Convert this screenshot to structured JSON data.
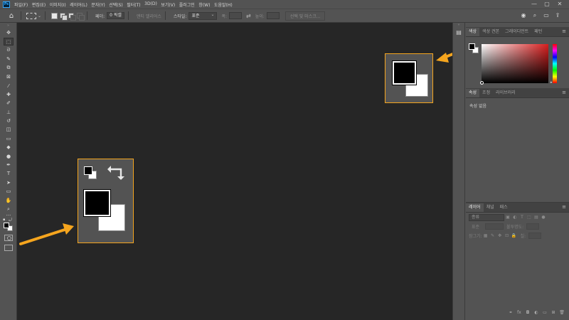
{
  "menubar": {
    "app_icon": "Ps",
    "items": [
      "파일(F)",
      "편집(E)",
      "이미지(I)",
      "레이어(L)",
      "문자(Y)",
      "선택(S)",
      "필터(T)",
      "3D(D)",
      "보기(V)",
      "플러그인",
      "창(W)",
      "도움말(H)"
    ],
    "window_controls": [
      "—",
      "▢",
      "✕"
    ]
  },
  "options": {
    "feather_label": "페더:",
    "feather_value": "0 픽셀",
    "antialias_label": "앤티 앨리어스",
    "style_label": "스타일:",
    "style_value": "표준",
    "width_label": "폭:",
    "height_label": "높이:",
    "select_mask_button": "선택 및 마스크..."
  },
  "tools": [
    "move-icon",
    "rect-marquee-icon",
    "lasso-icon",
    "quick-select-icon",
    "crop-icon",
    "frame-icon",
    "eyedropper-icon",
    "healing-icon",
    "brush-icon",
    "clone-stamp-icon",
    "history-brush-icon",
    "eraser-icon",
    "gradient-icon",
    "blur-icon",
    "dodge-icon",
    "pen-icon",
    "type-icon",
    "path-select-icon",
    "rectangle-icon",
    "hand-icon",
    "zoom-icon"
  ],
  "tool_glyphs": [
    "✥",
    "⬚",
    "ᘐ",
    "✎",
    "⧉",
    "⊠",
    "⁄",
    "✚",
    "✐",
    "⊥",
    "↺",
    "◫",
    "▭",
    "◆",
    "●",
    "✒",
    "T",
    "➤",
    "▭",
    "✋",
    "⌕"
  ],
  "colors": {
    "foreground": "#000000",
    "background": "#ffffff",
    "highlight": "#f5a51e",
    "canvas": "#262626",
    "panel": "#535353"
  },
  "panels": {
    "color_tabs": [
      "색상",
      "색상 견본",
      "그레이디언트",
      "패턴"
    ],
    "properties_tabs": [
      "속성",
      "조정",
      "라이브러리"
    ],
    "properties_empty": "속성 없음",
    "layers_tabs": [
      "레이어",
      "채널",
      "패스"
    ],
    "layers_search": "종류",
    "blend_mode": "표준",
    "opacity_label": "불투명도:",
    "lock_label": "잠그기:",
    "fill_label": "칠:"
  }
}
